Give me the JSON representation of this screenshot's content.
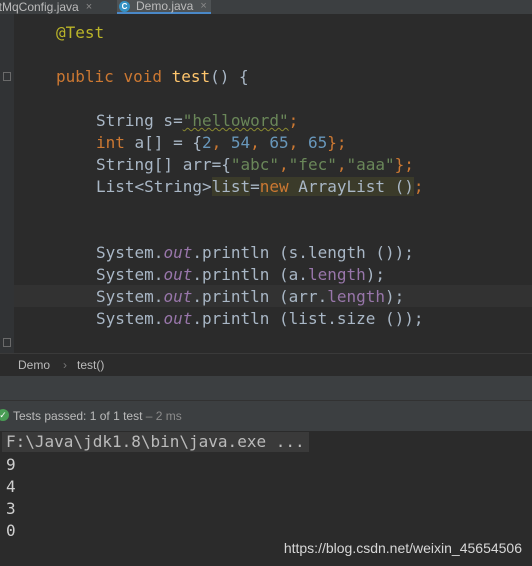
{
  "tabs": [
    {
      "label": "itMqConfig.java",
      "close": "×"
    },
    {
      "label": "Demo.java",
      "close": "×",
      "icon": "C"
    }
  ],
  "code": {
    "annotation": "@Test",
    "method": {
      "kw_public": "public",
      "kw_void": "void",
      "name": "test",
      "sig_rest": "() {"
    },
    "line1": {
      "type": "String",
      "var": " s=",
      "value": "\"helloword\"",
      "end": ";"
    },
    "line2": {
      "kw_int": "int",
      "var": " a[] = {",
      "n1": "2",
      "sep1": ", ",
      "n2": "54",
      "sep2": ", ",
      "n3": "65",
      "sep3": ", ",
      "n4": "65",
      "end": "};"
    },
    "line3": {
      "type": "String[] arr={",
      "s1": "\"abc\"",
      "c1": ",",
      "s2": "\"fec\"",
      "c2": ",",
      "s3": "\"aaa\"",
      "end": "};"
    },
    "line4": {
      "type": "List<String>",
      "var": "list",
      "eq": "=",
      "kw_new": "new",
      "ctor": " ArrayList ()",
      "end": ";"
    },
    "print1": {
      "cls": "System.",
      "out": "out",
      "call": ".println (s.length ());"
    },
    "print2": {
      "cls": "System.",
      "out": "out",
      "call_a": ".println (a.",
      "field": "length",
      "call_b": ");"
    },
    "print3": {
      "cls": "System.",
      "out": "out",
      "call_a": ".println (arr.",
      "field": "length",
      "call_b": ");"
    },
    "print4": {
      "cls": "System.",
      "out": "out",
      "call": ".println (list.size ());"
    }
  },
  "breadcrumb": {
    "class": "Demo",
    "sep": "›",
    "method": "test()"
  },
  "test_status": {
    "prefix": "Tests passed: ",
    "count": "1",
    "of": " of 1 test",
    "time": " – 2 ms",
    "icon": "check-circle-icon"
  },
  "console": {
    "command": "F:\\Java\\jdk1.8\\bin\\java.exe ...",
    "outputs": [
      "9",
      "4",
      "3",
      "0"
    ]
  },
  "watermark": "https://blog.csdn.net/weixin_45654506",
  "colors": {
    "keyword": "#cc7832",
    "string": "#6a8759",
    "number": "#6897bb",
    "field": "#9876aa",
    "method": "#ffc66d",
    "annotation": "#bbb529",
    "passed": "#499c54"
  }
}
